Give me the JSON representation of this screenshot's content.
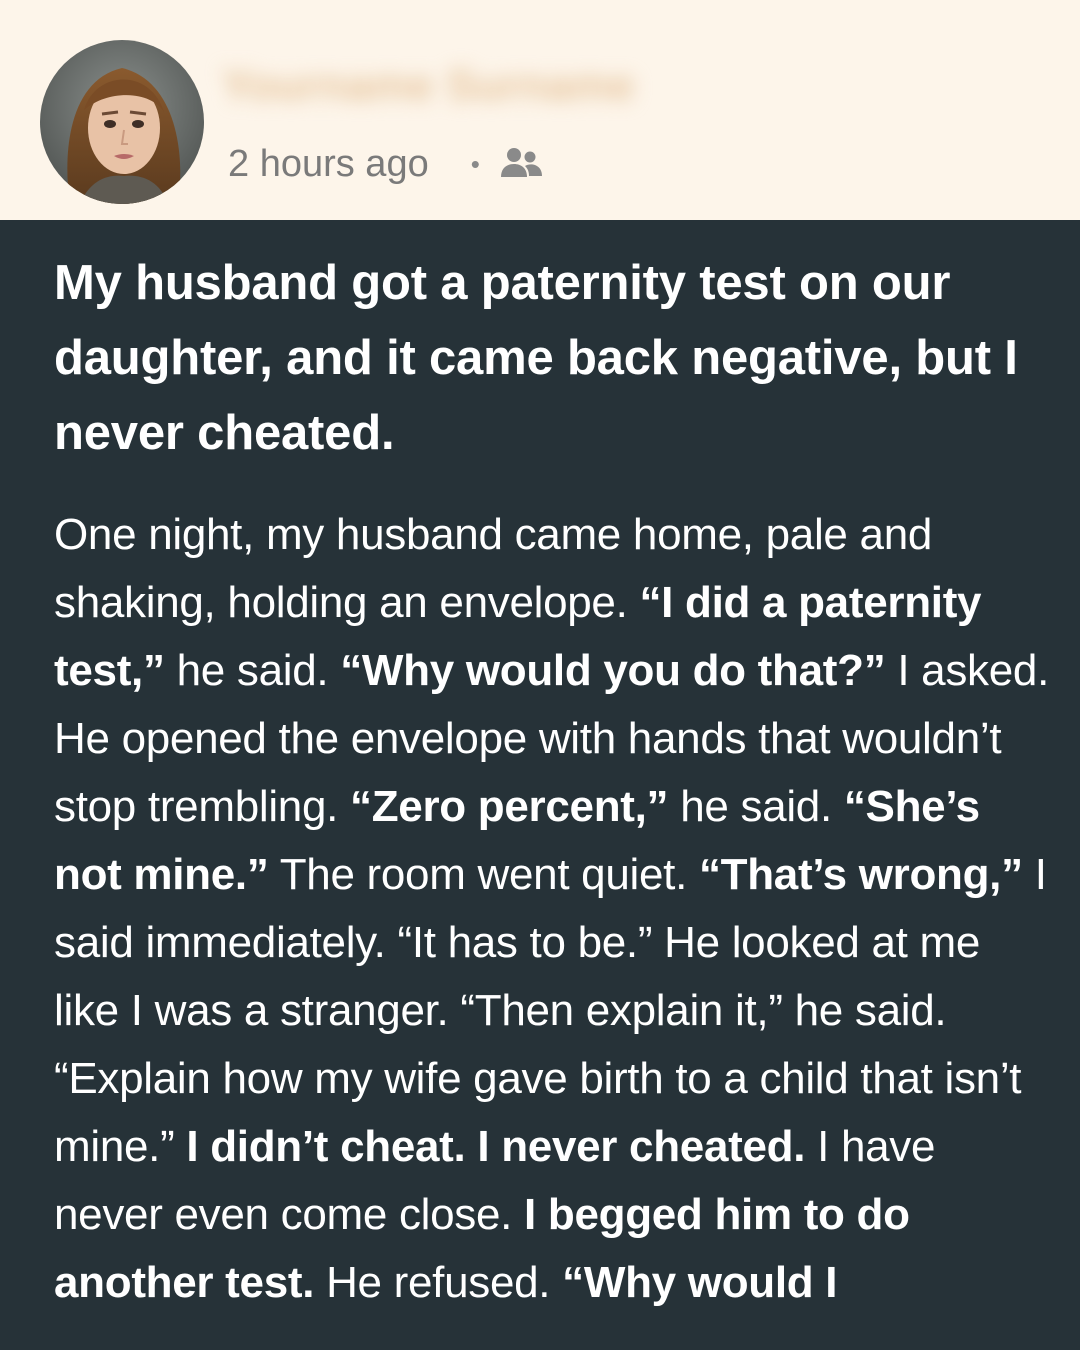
{
  "header": {
    "author_name": "Yourname Surname",
    "timestamp": "2 hours ago",
    "separator": "•",
    "audience_icon": "friends-icon"
  },
  "post": {
    "title": "My husband got a paternity test on our daughter, and it came back negative, but I never cheated.",
    "body": [
      {
        "t": "One night, my husband came home, pale and shaking, holding an envelope. ",
        "b": false
      },
      {
        "t": "“I did a paternity test,”",
        "b": true
      },
      {
        "t": " he said. ",
        "b": false
      },
      {
        "t": "“Why would you do that?”",
        "b": true
      },
      {
        "t": " I asked. He opened the envelope with hands that wouldn’t stop trembling. ",
        "b": false
      },
      {
        "t": "“Zero percent,”",
        "b": true
      },
      {
        "t": " he said. ",
        "b": false
      },
      {
        "t": "“She’s not mine.”",
        "b": true
      },
      {
        "t": " The room went quiet. ",
        "b": false
      },
      {
        "t": "“That’s wrong,”",
        "b": true
      },
      {
        "t": " I said immediately. “It has to be.” He looked at me like I was a stranger. “Then explain it,” he said. “Explain how my wife gave birth to a child that isn’t mine.” ",
        "b": false
      },
      {
        "t": "I didn’t cheat. I never cheated.",
        "b": true
      },
      {
        "t": " I have never even come close. ",
        "b": false
      },
      {
        "t": "I begged him to do another test.",
        "b": true
      },
      {
        "t": " He refused. ",
        "b": false
      },
      {
        "t": "“Why would I",
        "b": true
      }
    ]
  },
  "colors": {
    "header_bg": "#fdf5ea",
    "content_bg": "#263238",
    "text": "#ffffff",
    "meta_text": "#7a7a7a"
  }
}
